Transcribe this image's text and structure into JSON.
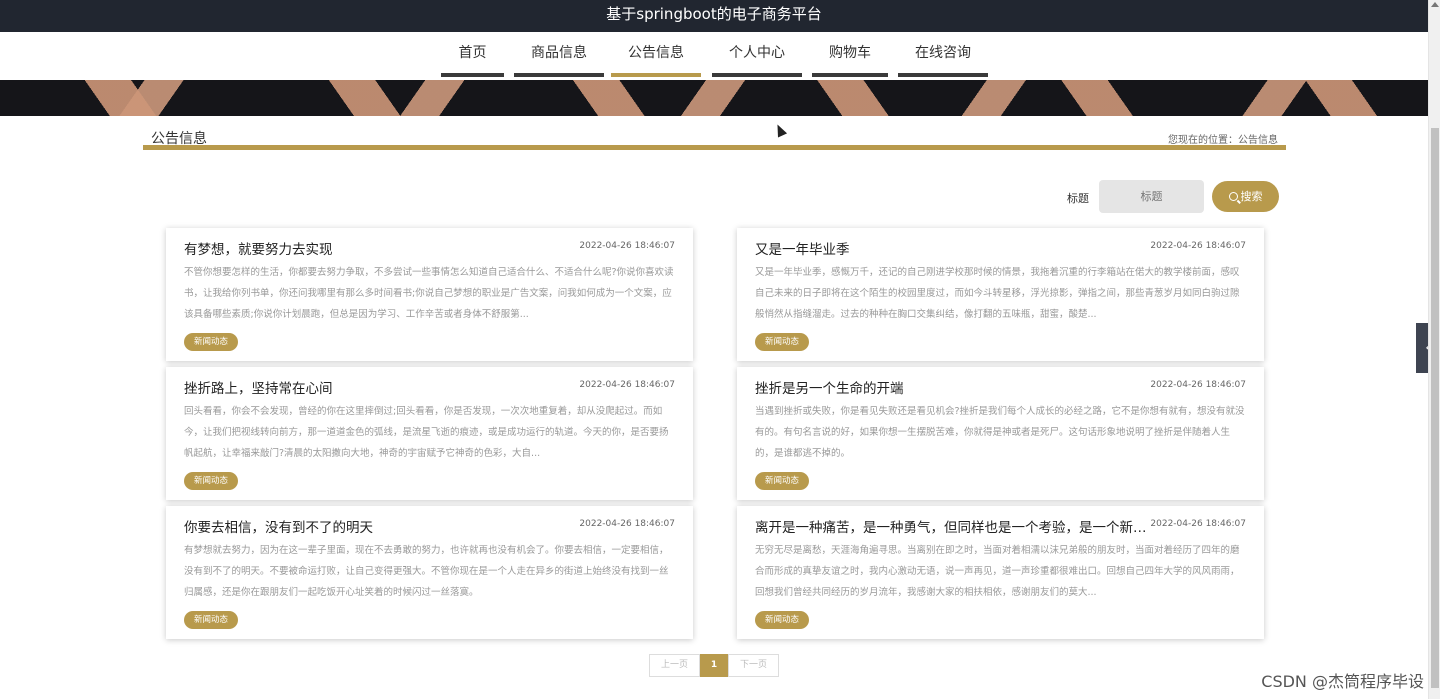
{
  "header": {
    "title": "基于springboot的电子商务平台"
  },
  "nav": {
    "items": [
      {
        "label": "首页"
      },
      {
        "label": "商品信息"
      },
      {
        "label": "公告信息"
      },
      {
        "label": "个人中心"
      },
      {
        "label": "购物车"
      },
      {
        "label": "在线咨询"
      }
    ],
    "active": "公告信息"
  },
  "section": {
    "title": "公告信息",
    "breadcrumb": "您现在的位置：公告信息"
  },
  "search": {
    "label": "标题",
    "placeholder": "标题",
    "button_label": "搜索"
  },
  "notices": [
    {
      "title": "有梦想，就要努力去实现",
      "time": "2022-04-26 18:46:07",
      "summary": "不管你想要怎样的生活，你都要去努力争取，不多尝试一些事情怎么知道自己适合什么、不适合什么呢?你说你喜欢读书，让我给你列书单，你还问我哪里有那么多时间看书;你说自己梦想的职业是广告文案，问我如何成为一个文案，应该具备哪些素质;你说你计划晨跑，但总是因为学习、工作辛苦或者身体不舒服第...",
      "tag": "新闻动态"
    },
    {
      "title": "又是一年毕业季",
      "time": "2022-04-26 18:46:07",
      "summary": "又是一年毕业季，感慨万千，还记的自己刚进学校那时候的情景，我拖着沉重的行李箱站在偌大的教学楼前面，感叹自己未来的日子即将在这个陌生的校园里度过，而如今斗转星移，浮光掠影，弹指之间，那些青葱岁月如同白驹过隙般悄然从指缝溜走。过去的种种在胸口交集纠结，像打翻的五味瓶，甜蜜，酸楚...",
      "tag": "新闻动态"
    },
    {
      "title": "挫折路上，坚持常在心间",
      "time": "2022-04-26 18:46:07",
      "summary": "回头看看，你会不会发现，曾经的你在这里摔倒过;回头看看，你是否发现，一次次地重复着，却从没爬起过。而如今，让我们把视线转向前方，那一道道金色的弧线，是流星飞逝的痕迹，或是成功运行的轨道。今天的你，是否要扬帆起航，让幸福来敲门?清晨的太阳撒向大地，神奇的宇宙赋予它神奇的色彩，大自...",
      "tag": "新闻动态"
    },
    {
      "title": "挫折是另一个生命的开端",
      "time": "2022-04-26 18:46:07",
      "summary": "当遇到挫折或失败，你是看见失败还是看见机会?挫折是我们每个人成长的必经之路，它不是你想有就有，想没有就没有的。有句名言说的好，如果你想一生摆脱苦难，你就得是神或者是死尸。这句话形象地说明了挫折是伴随着人生的，是谁都逃不掉的。",
      "tag": "新闻动态"
    },
    {
      "title": "你要去相信，没有到不了的明天",
      "time": "2022-04-26 18:46:07",
      "summary": "有梦想就去努力，因为在这一辈子里面，现在不去勇敢的努力，也许就再也没有机会了。你要去相信，一定要相信，没有到不了的明天。不要被命运打败，让自己变得更强大。不管你现在是一个人走在异乡的街道上始终没有找到一丝归属感，还是你在跟朋友们一起吃饭开心址笑着的时候闪过一丝落寞。",
      "tag": "新闻动态"
    },
    {
      "title": "离开是一种痛苦，是一种勇气，但同样也是一个考验，是一个新的...",
      "time": "2022-04-26 18:46:07",
      "summary": "无穷无尽是离愁，天涯海角遍寻思。当离别在即之时，当面对着相濡以沫兄弟般的朋友时，当面对着经历了四年的磨合而形成的真挚友谊之时，我内心激动无语，说一声再见，道一声珍重都很难出口。回想自己四年大学的风风雨雨，回想我们曾经共同经历的岁月流年，我感谢大家的相扶相依，感谢朋友们的莫大...",
      "tag": "新闻动态"
    }
  ],
  "pagination": {
    "prev_label": "上一页",
    "current_page": "1",
    "next_label": "下一页"
  },
  "side_toggle": {
    "icon": "‹",
    "icon_name": "chevron-left-icon"
  },
  "watermark": "CSDN @杰筒程序毕设",
  "colors": {
    "accent": "#b89a4c",
    "topbar": "#212630",
    "nav_bar": "#3a3a3a"
  }
}
